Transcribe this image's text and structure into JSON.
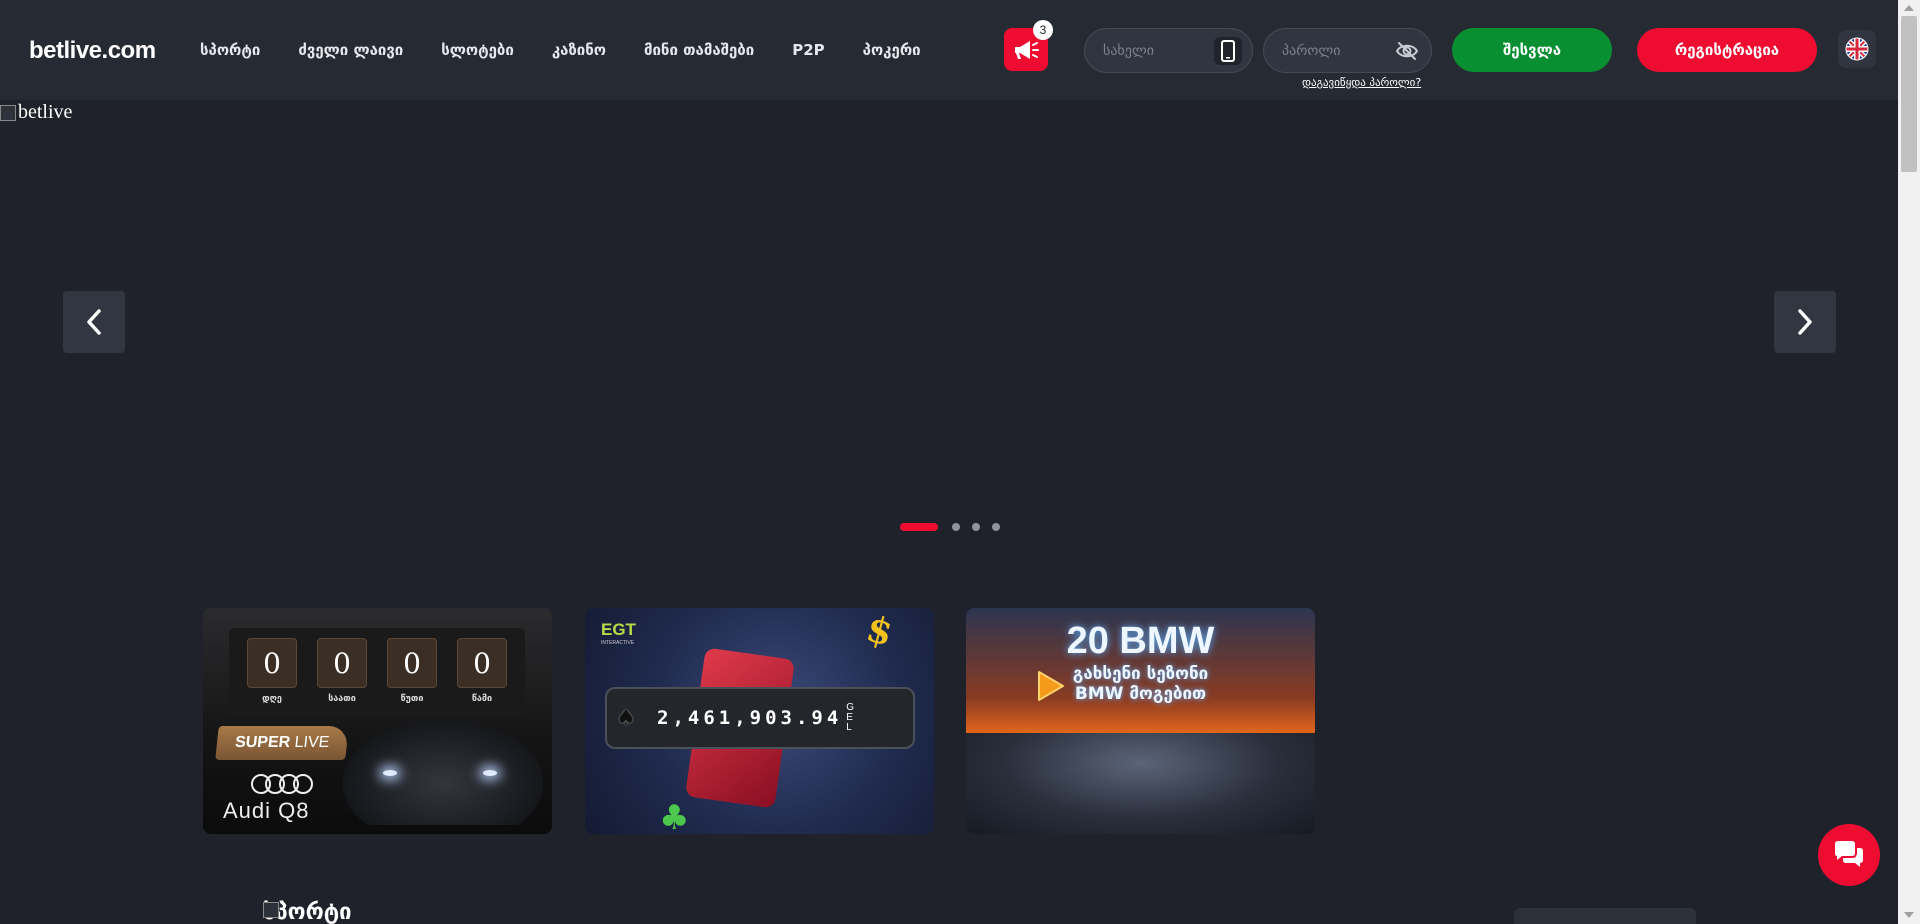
{
  "header": {
    "logo": "betlive.com",
    "nav": [
      "სპორტი",
      "ძველი ლაივი",
      "სლოტები",
      "კაზინო",
      "მინი თამაშები",
      "P2P",
      "პოკერი"
    ],
    "promo_badge_count": "3",
    "username_placeholder": "სახელი",
    "password_placeholder": "პაროლი",
    "forgot_password": "დაგავიწყდა პაროლი?",
    "login_label": "შესვლა",
    "register_label": "რეგისტრაცია",
    "language_icon": "uk-flag-icon"
  },
  "hero": {
    "image_alt": "betlive",
    "slide_count": 4,
    "active_slide": 0
  },
  "promo_cards": {
    "timer": {
      "values": [
        "0",
        "0",
        "0",
        "0"
      ],
      "labels": [
        "დღე",
        "საათი",
        "წუთი",
        "წამი"
      ],
      "brand_super": "SUPER",
      "brand_live": " LIVE",
      "car_model": "Audi Q8"
    },
    "jackpot": {
      "provider": "EGT",
      "provider_sub": "INTERACTIVE",
      "amount": "2,461,903.94",
      "currency": "GEL"
    },
    "bmw": {
      "title": "20 BMW",
      "subtitle_line1": "გახსენი სეზონი",
      "subtitle_line2": "BMW მოგებით"
    }
  },
  "section": {
    "title": "სპორტი"
  },
  "colors": {
    "accent_red": "#ee0d31",
    "login_green": "#078f32",
    "header_bg": "#262a33",
    "page_bg": "#1f222b"
  }
}
